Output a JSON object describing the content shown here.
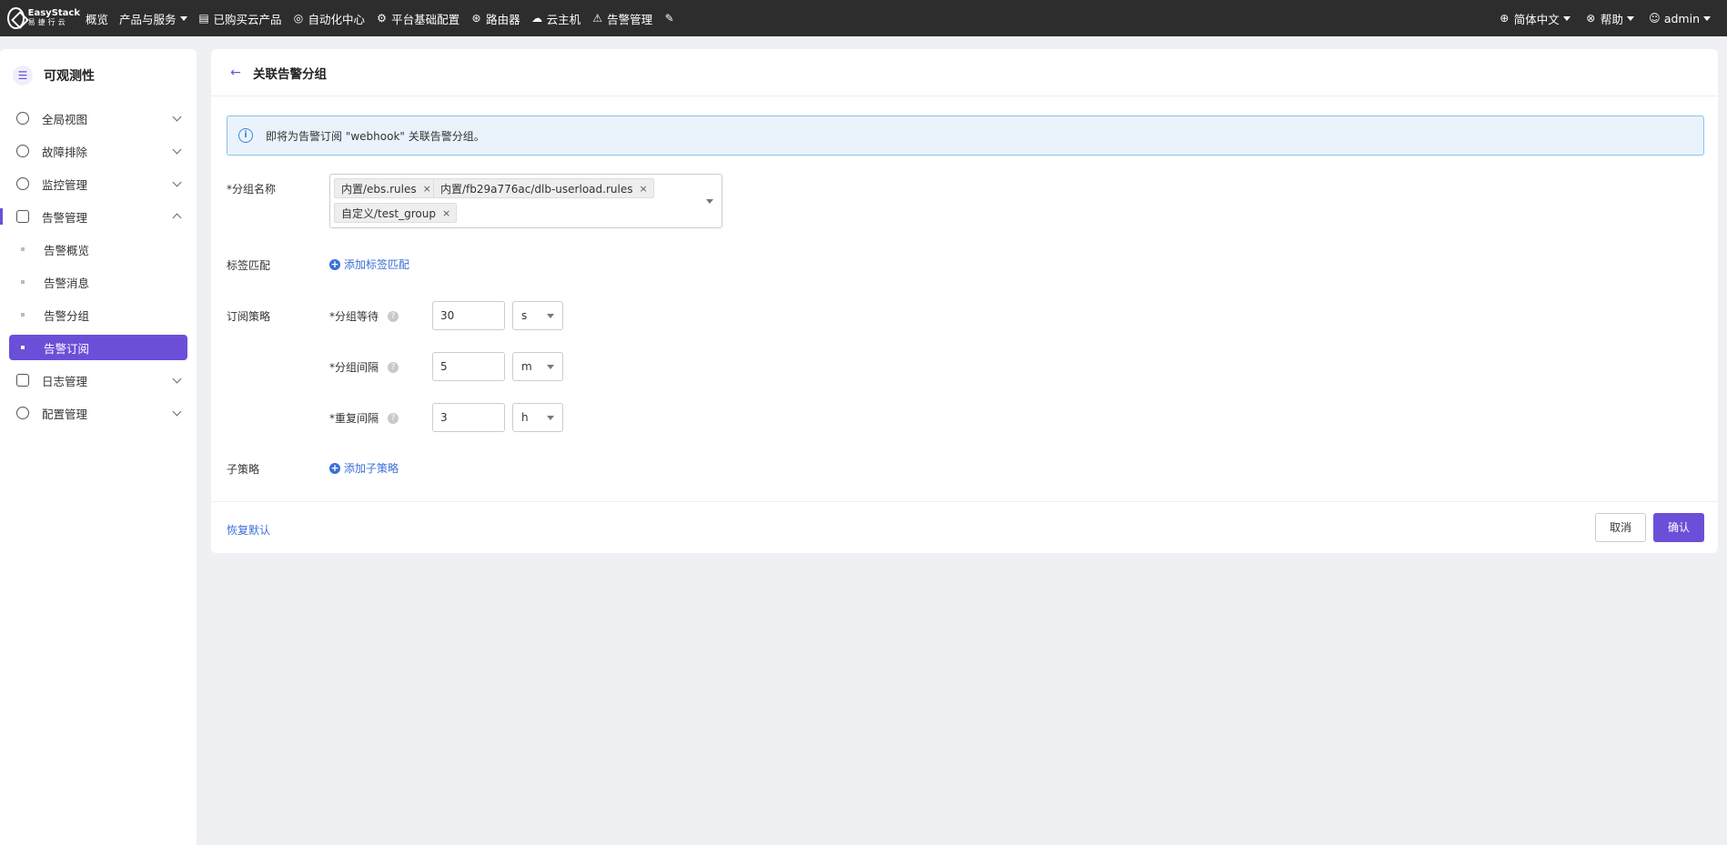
{
  "brand": {
    "name_en": "EasyStack",
    "name_cn": "易捷行云"
  },
  "topnav": {
    "items": [
      {
        "label": "概览",
        "icon": ""
      },
      {
        "label": "产品与服务",
        "icon": ""
      },
      {
        "label": "已购买云产品",
        "icon": "list-icon"
      },
      {
        "label": "自动化中心",
        "icon": "automation-icon"
      },
      {
        "label": "平台基础配置",
        "icon": "gear-icon"
      },
      {
        "label": "路由器",
        "icon": "router-icon"
      },
      {
        "label": "云主机",
        "icon": "cloud-icon"
      },
      {
        "label": "告警管理",
        "icon": "alarm-icon"
      }
    ],
    "pin_icon": "pin-icon",
    "language": "简体中文",
    "help": "帮助",
    "user": "admin"
  },
  "sidebar": {
    "title": "可观测性",
    "items": [
      {
        "label": "全局视图",
        "icon": "dashboard-icon"
      },
      {
        "label": "故障排除",
        "icon": "troubleshoot-icon"
      },
      {
        "label": "监控管理",
        "icon": "monitor-icon"
      },
      {
        "label": "告警管理",
        "icon": "alarm-icon"
      },
      {
        "label": "日志管理",
        "icon": "log-icon"
      },
      {
        "label": "配置管理",
        "icon": "settings-icon"
      }
    ],
    "alarm_subitems": [
      {
        "label": "告警概览"
      },
      {
        "label": "告警消息"
      },
      {
        "label": "告警分组"
      },
      {
        "label": "告警订阅",
        "active": true
      }
    ]
  },
  "main": {
    "title": "关联告警分组",
    "alert": "即将为告警订阅 \"webhook\" 关联告警分组。",
    "group_name_label": "*分组名称",
    "tags": [
      "内置/ebs.rules",
      "内置/fb29a776ac/dlb-userload.rules",
      "自定义/test_group"
    ],
    "label_match_label": "标签匹配",
    "add_label_match": "添加标签匹配",
    "policy_label": "订阅策略",
    "policies": [
      {
        "label": "*分组等待",
        "value": "30",
        "unit": "s"
      },
      {
        "label": "*分组间隔",
        "value": "5",
        "unit": "m"
      },
      {
        "label": "*重复间隔",
        "value": "3",
        "unit": "h"
      }
    ],
    "sub_policy_label": "子策略",
    "add_sub_policy": "添加子策略",
    "restore_default": "恢复默认",
    "cancel": "取消",
    "confirm": "确认"
  },
  "colors": {
    "accent": "#6b4fd8",
    "link": "#3a6fd8",
    "topbar": "#2d2d2d",
    "alert_bg": "#eaf3fb"
  }
}
